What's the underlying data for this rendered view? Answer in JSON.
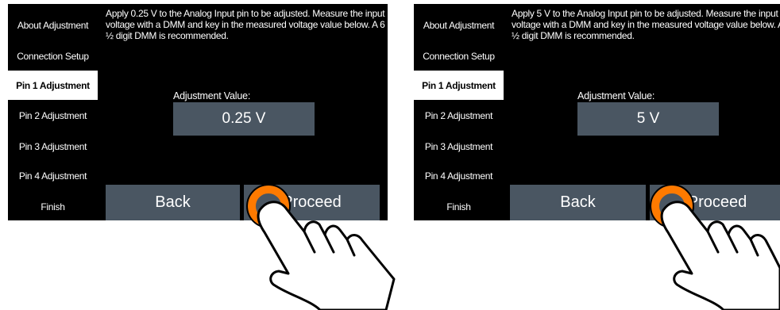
{
  "left": {
    "nav": [
      {
        "label": "About Adjustment"
      },
      {
        "label": "Connection Setup"
      },
      {
        "label": "Pin 1 Adjustment"
      },
      {
        "label": "Pin 2 Adjustment"
      },
      {
        "label": "Pin 3 Adjustment"
      },
      {
        "label": "Pin 4 Adjustment"
      },
      {
        "label": "Finish"
      }
    ],
    "active_nav": "Pin 1 Adjustment",
    "instruction_lines": [
      "Apply 0.25 V to the Analog Input pin to be adjusted. Measure the input",
      "voltage with a DMM and key in the measured voltage value below. A 6",
      "½ digit DMM is recommended."
    ],
    "adjustment_label": "Adjustment Value:",
    "adjustment_value": "0.25 V",
    "back_label": "Back",
    "proceed_label": "Proceed"
  },
  "right": {
    "nav": [
      {
        "label": "About Adjustment"
      },
      {
        "label": "Connection Setup"
      },
      {
        "label": "Pin 1 Adjustment"
      },
      {
        "label": "Pin 2 Adjustment"
      },
      {
        "label": "Pin 3 Adjustment"
      },
      {
        "label": "Pin 4 Adjustment"
      },
      {
        "label": "Finish"
      }
    ],
    "active_nav": "Pin 1 Adjustment",
    "instruction_lines": [
      "Apply 5 V to the Analog Input pin to be adjusted. Measure the input",
      "voltage with a DMM and key in the measured voltage value below. A 6",
      "½ digit DMM is recommended."
    ],
    "adjustment_label": "Adjustment Value:",
    "adjustment_value": "5 V",
    "back_label": "Back",
    "proceed_label": "Proceed"
  },
  "colors": {
    "panel_bg": "#000000",
    "control_bg": "#4a5662",
    "active_nav_bg": "#ffffff",
    "tap_ring": "#ff7a00"
  },
  "icons": {
    "tap_indicator": "tap-ring-icon",
    "hand": "pointing-hand-icon"
  }
}
